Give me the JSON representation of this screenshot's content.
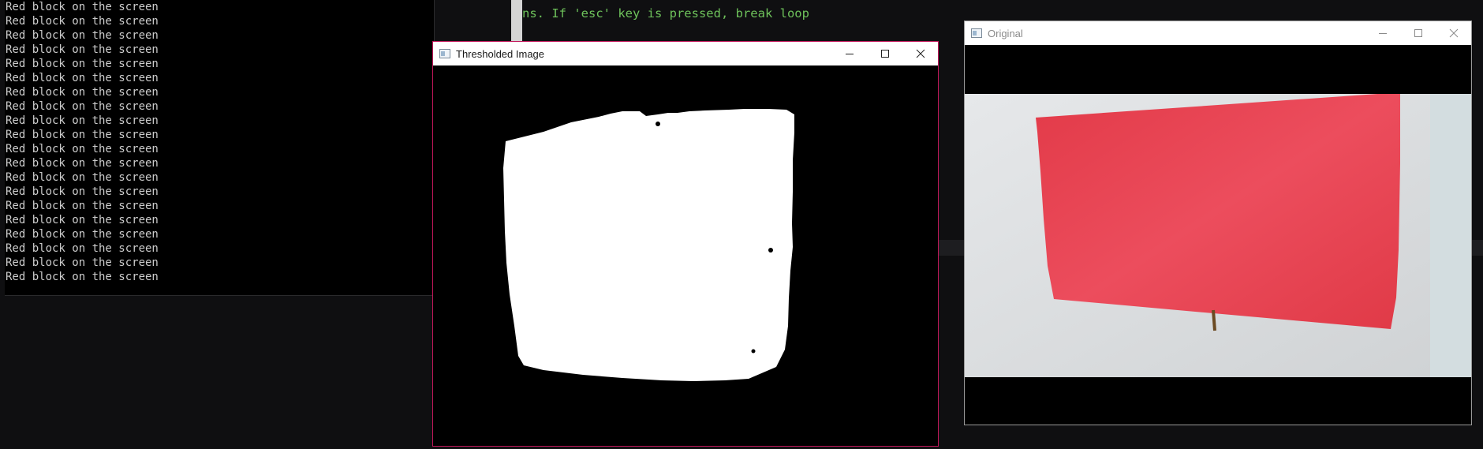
{
  "console": {
    "lines": [
      "Red block on the screen",
      "Red block on the screen",
      "Red block on the screen",
      "Red block on the screen",
      "Red block on the screen",
      "Red block on the screen",
      "Red block on the screen",
      "Red block on the screen",
      "Red block on the screen",
      "Red block on the screen",
      "Red block on the screen",
      "Red block on the screen",
      "Red block on the screen",
      "Red block on the screen",
      "Red block on the screen",
      "Red block on the screen",
      "Red block on the screen",
      "Red block on the screen",
      "Red block on the screen",
      "Red block on the screen"
    ]
  },
  "editor": {
    "visible_text": "ns. If 'esc' key is pressed, break loop"
  },
  "windows": {
    "thresholded": {
      "title": "Thresholded Image",
      "icon": "app-window-icon"
    },
    "original": {
      "title": "Original",
      "icon": "app-window-icon"
    }
  },
  "colors": {
    "thresholded_border": "#c2185b",
    "editor_comment": "#6ec25b",
    "red_block": "#e8434f",
    "background": "#0f0f11"
  }
}
